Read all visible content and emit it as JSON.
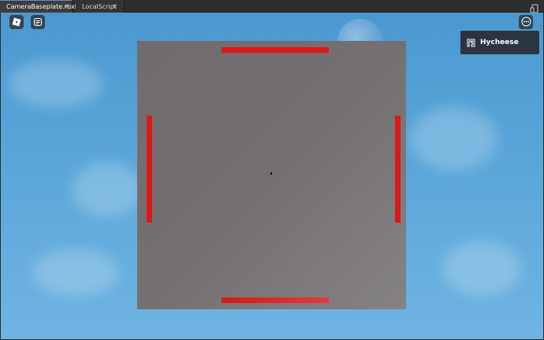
{
  "tabs": [
    {
      "label": "CameraBaseplate.rbxl",
      "close": "✕",
      "active": true
    },
    {
      "label": "LocalScript",
      "close": "✕",
      "active": false
    }
  ],
  "toolbar": {
    "device_icon": "device-emulator-icon"
  },
  "game": {
    "roblox_button_icon": "roblox-logo-icon",
    "chat_button_icon": "chat-icon",
    "menu_button_icon": "more-options-icon"
  },
  "player_list": {
    "players": [
      {
        "name": "Hycheese",
        "icon": "premium-icon"
      }
    ]
  },
  "colors": {
    "sky": "#5aa6d9",
    "frame": "#747072",
    "bars": "#dc1818",
    "panel": "#282c32"
  }
}
